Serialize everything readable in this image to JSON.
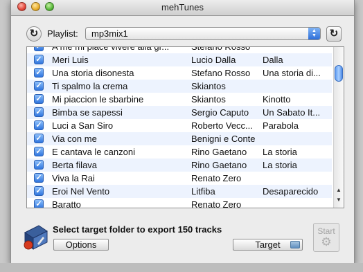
{
  "window": {
    "title": "mehTunes"
  },
  "toolbar": {
    "refresh_left_glyph": "↻",
    "playlist_label": "Playlist:",
    "playlist_value": "mp3mix1",
    "refresh_right_glyph": "↻"
  },
  "tracks": [
    {
      "checked": true,
      "title": "A me mi piace vivere alla gr...",
      "artist": "Stefano Rosso",
      "album": ""
    },
    {
      "checked": true,
      "title": "Meri Luis",
      "artist": "Lucio Dalla",
      "album": "Dalla"
    },
    {
      "checked": true,
      "title": "Una storia disonesta",
      "artist": "Stefano Rosso",
      "album": "Una storia di..."
    },
    {
      "checked": true,
      "title": "Ti spalmo la crema",
      "artist": "Skiantos",
      "album": ""
    },
    {
      "checked": true,
      "title": "Mi piaccion le sbarbine",
      "artist": "Skiantos",
      "album": "Kinotto"
    },
    {
      "checked": true,
      "title": "Bimba se sapessi",
      "artist": "Sergio Caputo",
      "album": "Un Sabato It..."
    },
    {
      "checked": true,
      "title": "Luci a San Siro",
      "artist": "Roberto Vecc...",
      "album": "Parabola"
    },
    {
      "checked": true,
      "title": "Via con me",
      "artist": "Benigni e Conte",
      "album": ""
    },
    {
      "checked": true,
      "title": "E cantava le canzoni",
      "artist": "Rino Gaetano",
      "album": "La storia"
    },
    {
      "checked": true,
      "title": "Berta filava",
      "artist": "Rino Gaetano",
      "album": "La storia"
    },
    {
      "checked": true,
      "title": "Viva la Rai",
      "artist": "Renato Zero",
      "album": ""
    },
    {
      "checked": true,
      "title": "Eroi Nel Vento",
      "artist": "Litfiba",
      "album": "Desaparecido"
    },
    {
      "checked": true,
      "title": "Baratto",
      "artist": "Renato Zero",
      "album": ""
    }
  ],
  "footer": {
    "export_message": "Select target folder to export 150 tracks",
    "options_label": "Options",
    "target_label": "Target",
    "start_label": "Start"
  },
  "icons": {
    "checkbox_check": "✓",
    "scroll_up": "▲",
    "scroll_down": "▼",
    "select_up": "▲",
    "select_down": "▼",
    "gear": "⚙"
  }
}
